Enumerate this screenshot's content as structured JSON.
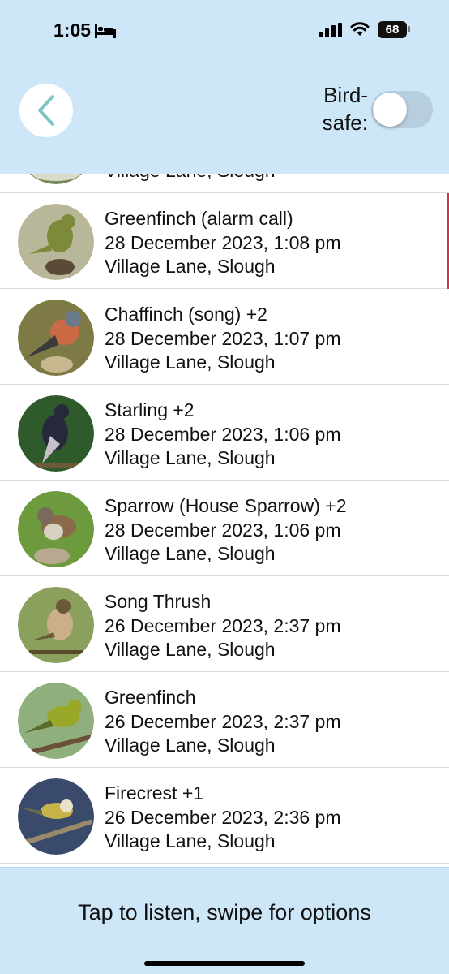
{
  "status_bar": {
    "time": "1:05",
    "battery": "68"
  },
  "header": {
    "birdsafe_label_line1": "Bird-",
    "birdsafe_label_line2": "safe:",
    "birdsafe_on": false
  },
  "recordings": [
    {
      "title": "",
      "date": "",
      "location": "Village Lane, Slough",
      "thumb_colors": [
        "#7a8a5a",
        "#d8dcc8",
        "#4a5a3a"
      ]
    },
    {
      "title": "Greenfinch (alarm call)",
      "date": "28 December 2023, 1:08 pm",
      "location": "Village Lane, Slough",
      "thumb_colors": [
        "#b9b79a",
        "#7c8a3a",
        "#5a4a38"
      ]
    },
    {
      "title": "Chaffinch (song) +2",
      "date": "28 December 2023, 1:07 pm",
      "location": "Village Lane, Slough",
      "thumb_colors": [
        "#7d7a45",
        "#c96a45",
        "#3a3a3a"
      ]
    },
    {
      "title": "Starling +2",
      "date": "28 December 2023, 1:06 pm",
      "location": "Village Lane, Slough",
      "thumb_colors": [
        "#2f5a2c",
        "#27283a",
        "#c8c0c8"
      ]
    },
    {
      "title": "Sparrow (House Sparrow) +2",
      "date": "28 December 2023, 1:06 pm",
      "location": "Village Lane, Slough",
      "thumb_colors": [
        "#6c9a3c",
        "#8a6a4a",
        "#b8a890"
      ]
    },
    {
      "title": "Song Thrush",
      "date": "26 December 2023, 2:37 pm",
      "location": "Village Lane, Slough",
      "thumb_colors": [
        "#8aa05c",
        "#c9b08a",
        "#6a5a3a"
      ]
    },
    {
      "title": "Greenfinch",
      "date": "26 December 2023, 2:37 pm",
      "location": "Village Lane, Slough",
      "thumb_colors": [
        "#8fb07c",
        "#9aa82a",
        "#6a5038"
      ]
    },
    {
      "title": "Firecrest +1",
      "date": "26 December 2023, 2:36 pm",
      "location": "Village Lane, Slough",
      "thumb_colors": [
        "#3a4a6a",
        "#c8b24a",
        "#9a8a6a"
      ]
    }
  ],
  "footer": {
    "hint": "Tap to listen, swipe for options"
  }
}
